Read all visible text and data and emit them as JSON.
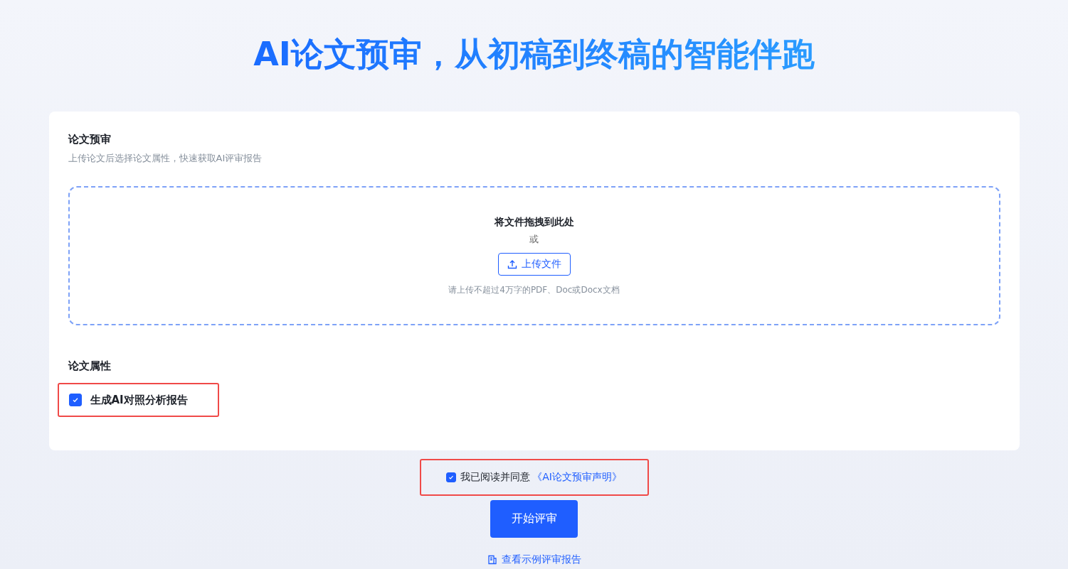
{
  "headline": "AI论文预审，从初稿到终稿的智能伴跑",
  "card": {
    "title": "论文预审",
    "subtitle": "上传论文后选择论文属性，快速获取AI评审报告",
    "dropzone": {
      "title": "将文件拖拽到此处",
      "or": "或",
      "upload_button": "上传文件",
      "hint": "请上传不超过4万字的PDF、Doc或Docx文档"
    },
    "properties_title": "论文属性",
    "options": [
      {
        "label": "生成AI对照分析报告",
        "checked": true,
        "highlighted": true
      }
    ]
  },
  "agreement": {
    "checked": true,
    "highlighted": true,
    "text": "我已阅读并同意",
    "link": "《AI论文预审声明》"
  },
  "start_button": "开始评审",
  "sample_link": "查看示例评审报告"
}
